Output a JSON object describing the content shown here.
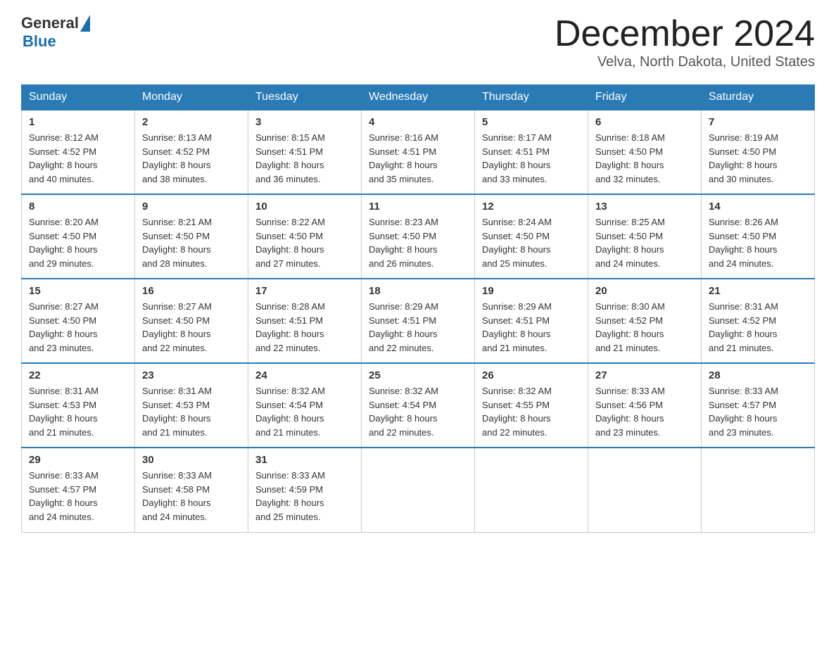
{
  "header": {
    "logo": {
      "general": "General",
      "blue": "Blue"
    },
    "title": "December 2024",
    "location": "Velva, North Dakota, United States"
  },
  "days_of_week": [
    "Sunday",
    "Monday",
    "Tuesday",
    "Wednesday",
    "Thursday",
    "Friday",
    "Saturday"
  ],
  "weeks": [
    [
      {
        "day": "1",
        "sunrise": "8:12 AM",
        "sunset": "4:52 PM",
        "daylight": "8 hours and 40 minutes."
      },
      {
        "day": "2",
        "sunrise": "8:13 AM",
        "sunset": "4:52 PM",
        "daylight": "8 hours and 38 minutes."
      },
      {
        "day": "3",
        "sunrise": "8:15 AM",
        "sunset": "4:51 PM",
        "daylight": "8 hours and 36 minutes."
      },
      {
        "day": "4",
        "sunrise": "8:16 AM",
        "sunset": "4:51 PM",
        "daylight": "8 hours and 35 minutes."
      },
      {
        "day": "5",
        "sunrise": "8:17 AM",
        "sunset": "4:51 PM",
        "daylight": "8 hours and 33 minutes."
      },
      {
        "day": "6",
        "sunrise": "8:18 AM",
        "sunset": "4:50 PM",
        "daylight": "8 hours and 32 minutes."
      },
      {
        "day": "7",
        "sunrise": "8:19 AM",
        "sunset": "4:50 PM",
        "daylight": "8 hours and 30 minutes."
      }
    ],
    [
      {
        "day": "8",
        "sunrise": "8:20 AM",
        "sunset": "4:50 PM",
        "daylight": "8 hours and 29 minutes."
      },
      {
        "day": "9",
        "sunrise": "8:21 AM",
        "sunset": "4:50 PM",
        "daylight": "8 hours and 28 minutes."
      },
      {
        "day": "10",
        "sunrise": "8:22 AM",
        "sunset": "4:50 PM",
        "daylight": "8 hours and 27 minutes."
      },
      {
        "day": "11",
        "sunrise": "8:23 AM",
        "sunset": "4:50 PM",
        "daylight": "8 hours and 26 minutes."
      },
      {
        "day": "12",
        "sunrise": "8:24 AM",
        "sunset": "4:50 PM",
        "daylight": "8 hours and 25 minutes."
      },
      {
        "day": "13",
        "sunrise": "8:25 AM",
        "sunset": "4:50 PM",
        "daylight": "8 hours and 24 minutes."
      },
      {
        "day": "14",
        "sunrise": "8:26 AM",
        "sunset": "4:50 PM",
        "daylight": "8 hours and 24 minutes."
      }
    ],
    [
      {
        "day": "15",
        "sunrise": "8:27 AM",
        "sunset": "4:50 PM",
        "daylight": "8 hours and 23 minutes."
      },
      {
        "day": "16",
        "sunrise": "8:27 AM",
        "sunset": "4:50 PM",
        "daylight": "8 hours and 22 minutes."
      },
      {
        "day": "17",
        "sunrise": "8:28 AM",
        "sunset": "4:51 PM",
        "daylight": "8 hours and 22 minutes."
      },
      {
        "day": "18",
        "sunrise": "8:29 AM",
        "sunset": "4:51 PM",
        "daylight": "8 hours and 22 minutes."
      },
      {
        "day": "19",
        "sunrise": "8:29 AM",
        "sunset": "4:51 PM",
        "daylight": "8 hours and 21 minutes."
      },
      {
        "day": "20",
        "sunrise": "8:30 AM",
        "sunset": "4:52 PM",
        "daylight": "8 hours and 21 minutes."
      },
      {
        "day": "21",
        "sunrise": "8:31 AM",
        "sunset": "4:52 PM",
        "daylight": "8 hours and 21 minutes."
      }
    ],
    [
      {
        "day": "22",
        "sunrise": "8:31 AM",
        "sunset": "4:53 PM",
        "daylight": "8 hours and 21 minutes."
      },
      {
        "day": "23",
        "sunrise": "8:31 AM",
        "sunset": "4:53 PM",
        "daylight": "8 hours and 21 minutes."
      },
      {
        "day": "24",
        "sunrise": "8:32 AM",
        "sunset": "4:54 PM",
        "daylight": "8 hours and 21 minutes."
      },
      {
        "day": "25",
        "sunrise": "8:32 AM",
        "sunset": "4:54 PM",
        "daylight": "8 hours and 22 minutes."
      },
      {
        "day": "26",
        "sunrise": "8:32 AM",
        "sunset": "4:55 PM",
        "daylight": "8 hours and 22 minutes."
      },
      {
        "day": "27",
        "sunrise": "8:33 AM",
        "sunset": "4:56 PM",
        "daylight": "8 hours and 23 minutes."
      },
      {
        "day": "28",
        "sunrise": "8:33 AM",
        "sunset": "4:57 PM",
        "daylight": "8 hours and 23 minutes."
      }
    ],
    [
      {
        "day": "29",
        "sunrise": "8:33 AM",
        "sunset": "4:57 PM",
        "daylight": "8 hours and 24 minutes."
      },
      {
        "day": "30",
        "sunrise": "8:33 AM",
        "sunset": "4:58 PM",
        "daylight": "8 hours and 24 minutes."
      },
      {
        "day": "31",
        "sunrise": "8:33 AM",
        "sunset": "4:59 PM",
        "daylight": "8 hours and 25 minutes."
      },
      null,
      null,
      null,
      null
    ]
  ],
  "labels": {
    "sunrise": "Sunrise:",
    "sunset": "Sunset:",
    "daylight": "Daylight:"
  }
}
